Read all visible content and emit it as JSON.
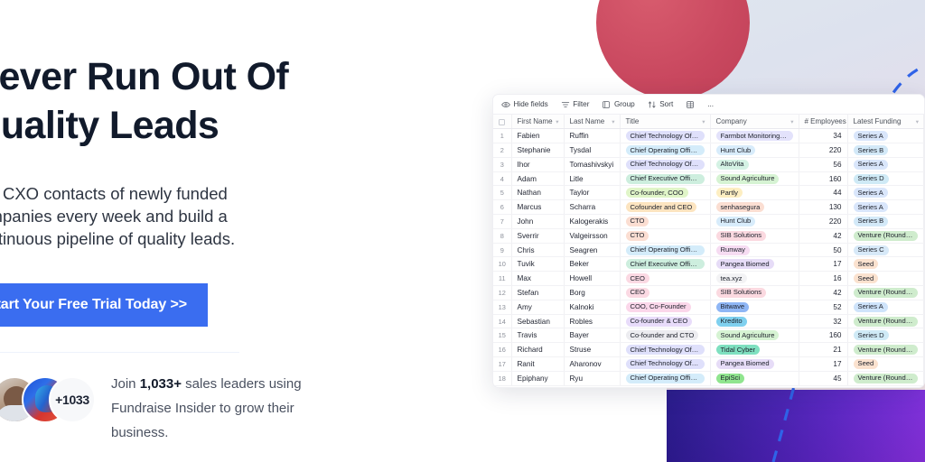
{
  "hero": {
    "headline_line1": "Never Run Out Of",
    "headline_line2": "Quality Leads",
    "sub_line1": "Get CXO contacts of newly funded",
    "sub_line2": "companies every week and build a",
    "sub_line3": "continuous pipeline of quality leads.",
    "cta_label": "Start Your Free Trial Today >>",
    "avatar_badge": "+1033",
    "proof_prefix": "Join ",
    "proof_count": "1,033+",
    "proof_suffix": " sales leaders using Fundraise Insider to grow their business.",
    "cta_color": "#3a6df0"
  },
  "grid": {
    "toolbar": [
      {
        "icon": "eye-icon",
        "label": "Hide fields"
      },
      {
        "icon": "filter-icon",
        "label": "Filter"
      },
      {
        "icon": "group-icon",
        "label": "Group"
      },
      {
        "icon": "sort-icon",
        "label": "Sort"
      },
      {
        "icon": "row-height-icon",
        "label": ""
      },
      {
        "icon": "more-icon",
        "label": "..."
      }
    ],
    "columns": [
      "First Name",
      "Last Name",
      "Title",
      "Company",
      "# Employees",
      "Latest Funding"
    ],
    "rows": [
      {
        "n": "1",
        "first": "Fabien",
        "last": "Ruffin",
        "title": "Chief Technology Officer",
        "title_color": "#dfe0fb",
        "company": "Farmbot Monitoring So...",
        "company_color": "#e3e2fb",
        "employees": "34",
        "funding": "Series A",
        "funding_color": "#d9e6fb"
      },
      {
        "n": "2",
        "first": "Stephanie",
        "last": "Tysdal",
        "title": "Chief Operating Officer",
        "title_color": "#d4ecfa",
        "company": "Hunt Club",
        "company_color": "#d8ecfb",
        "employees": "220",
        "funding": "Series B",
        "funding_color": "#d3e9f8"
      },
      {
        "n": "3",
        "first": "Ihor",
        "last": "Tomashivskyi",
        "title": "Chief Technology Officer",
        "title_color": "#dfe0fb",
        "company": "AltoVita",
        "company_color": "#d4f2e4",
        "employees": "56",
        "funding": "Series A",
        "funding_color": "#d9e6fb"
      },
      {
        "n": "4",
        "first": "Adam",
        "last": "Litle",
        "title": "Chief Executive Officer",
        "title_color": "#cdeede",
        "company": "Sound Agriculture",
        "company_color": "#d6f3d3",
        "employees": "160",
        "funding": "Series D",
        "funding_color": "#cfeaf6"
      },
      {
        "n": "5",
        "first": "Nathan",
        "last": "Taylor",
        "title": "Co-founder, COO",
        "title_color": "#e0f5c8",
        "company": "Partly",
        "company_color": "#fdeec2",
        "employees": "44",
        "funding": "Series A",
        "funding_color": "#d9e6fb"
      },
      {
        "n": "6",
        "first": "Marcus",
        "last": "Scharra",
        "title": "Cofounder and CEO",
        "title_color": "#fce4c0",
        "company": "senhasegura",
        "company_color": "#fbded2",
        "employees": "130",
        "funding": "Series A",
        "funding_color": "#d9e6fb"
      },
      {
        "n": "7",
        "first": "John",
        "last": "Kalogerakis",
        "title": "CTO",
        "title_color": "#fbded2",
        "company": "Hunt Club",
        "company_color": "#d8ecfb",
        "employees": "220",
        "funding": "Series B",
        "funding_color": "#d3e9f8"
      },
      {
        "n": "8",
        "first": "Sverrir",
        "last": "Valgeirsson",
        "title": "CTO",
        "title_color": "#fbded2",
        "company": "SIB Solutions",
        "company_color": "#fbd9e0",
        "employees": "42",
        "funding": "Venture (Round not Sp...",
        "funding_color": "#cfeccd"
      },
      {
        "n": "9",
        "first": "Chris",
        "last": "Seagren",
        "title": "Chief Operating Officer",
        "title_color": "#d4ecfa",
        "company": "Runway",
        "company_color": "#f6dcf2",
        "employees": "50",
        "funding": "Series C",
        "funding_color": "#d7e9f8"
      },
      {
        "n": "10",
        "first": "Tuvik",
        "last": "Beker",
        "title": "Chief Executive Officer",
        "title_color": "#cdeede",
        "company": "Pangea Biomed",
        "company_color": "#e6dcf7",
        "employees": "17",
        "funding": "Seed",
        "funding_color": "#fbe2cf"
      },
      {
        "n": "11",
        "first": "Max",
        "last": "Howell",
        "title": "CEO",
        "title_color": "#fbd9e3",
        "company": "tea.xyz",
        "company_color": "#f3f3f5",
        "employees": "16",
        "funding": "Seed",
        "funding_color": "#fbe2cf"
      },
      {
        "n": "12",
        "first": "Stefan",
        "last": "Borg",
        "title": "CEO",
        "title_color": "#fbd9e3",
        "company": "SIB Solutions",
        "company_color": "#fbd9e0",
        "employees": "42",
        "funding": "Venture (Round not Sp...",
        "funding_color": "#cfeccd"
      },
      {
        "n": "13",
        "first": "Amy",
        "last": "Kalnoki",
        "title": "COO, Co-Founder",
        "title_color": "#fbd7ea",
        "company": "Bitwave",
        "company_color": "#8fb6f5",
        "employees": "52",
        "funding": "Series A",
        "funding_color": "#cfe4fb"
      },
      {
        "n": "14",
        "first": "Sebastian",
        "last": "Robles",
        "title": "Co-founder & CEO",
        "title_color": "#e8dcfa",
        "company": "Kredito",
        "company_color": "#7fd0ef",
        "employees": "32",
        "funding": "Venture (Round not Sp...",
        "funding_color": "#cfeccd"
      },
      {
        "n": "15",
        "first": "Travis",
        "last": "Bayer",
        "title": "Co-founder and CTO",
        "title_color": "#ececf0",
        "company": "Sound Agriculture",
        "company_color": "#d6f3d3",
        "employees": "160",
        "funding": "Series D",
        "funding_color": "#cfeaf6"
      },
      {
        "n": "16",
        "first": "Richard",
        "last": "Struse",
        "title": "Chief Technology Officer",
        "title_color": "#dfe0fb",
        "company": "Tidal Cyber",
        "company_color": "#7fe0c0",
        "employees": "21",
        "funding": "Venture (Round not Sp...",
        "funding_color": "#cfeccd"
      },
      {
        "n": "17",
        "first": "Ranit",
        "last": "Aharonov",
        "title": "Chief Technology Officer",
        "title_color": "#dfe0fb",
        "company": "Pangea Biomed",
        "company_color": "#e6dcf7",
        "employees": "17",
        "funding": "Seed",
        "funding_color": "#fbe2cf"
      },
      {
        "n": "18",
        "first": "Epiphany",
        "last": "Ryu",
        "title": "Chief Operating Officer",
        "title_color": "#d4ecfa",
        "company": "EpiSci",
        "company_color": "#90e58f",
        "employees": "45",
        "funding": "Venture (Round not Sp...",
        "funding_color": "#cfeccd"
      }
    ]
  }
}
